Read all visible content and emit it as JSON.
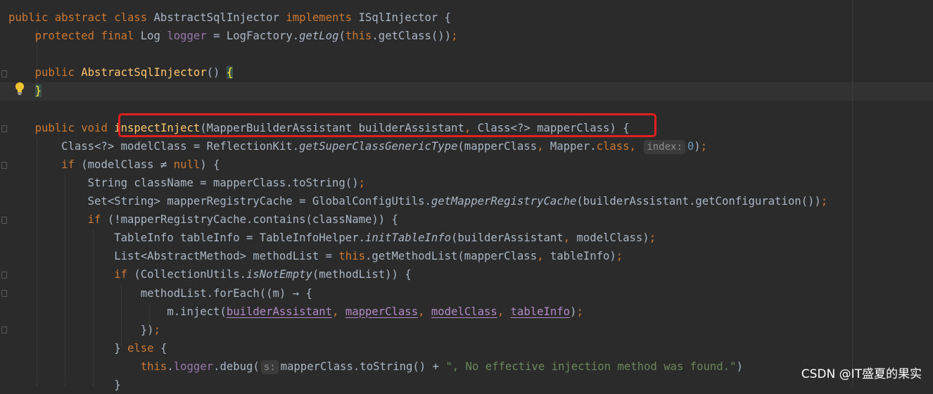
{
  "editor": {
    "lines": [
      [
        [
          "k",
          "public abstract class "
        ],
        [
          "t",
          "AbstractSqlInjector "
        ],
        [
          "k",
          "implements "
        ],
        [
          "t",
          "ISqlInjector {"
        ]
      ],
      [
        [
          "t",
          "    "
        ],
        [
          "k",
          "protected final "
        ],
        [
          "t",
          "Log "
        ],
        [
          "st",
          "logger"
        ],
        [
          "t",
          " = LogFactory."
        ],
        [
          "i",
          "getLog"
        ],
        [
          "t",
          "("
        ],
        [
          "k",
          "this"
        ],
        [
          "t",
          ".getClass())"
        ],
        [
          "k",
          ";"
        ]
      ],
      [],
      [
        [
          "t",
          "    "
        ],
        [
          "k",
          "public "
        ],
        [
          "f",
          "AbstractSqlInjector"
        ],
        [
          "t",
          "() "
        ],
        [
          "bm",
          "{"
        ]
      ],
      [
        [
          "t",
          "    "
        ],
        [
          "bm",
          "}"
        ]
      ],
      [],
      [
        [
          "t",
          "    "
        ],
        [
          "k",
          "public void "
        ],
        [
          "f",
          "inspectInject"
        ],
        [
          "t",
          "(MapperBuilderAssistant builderAssistant"
        ],
        [
          "k",
          ", "
        ],
        [
          "t",
          "Class<?> mapperClass) {"
        ]
      ],
      [
        [
          "t",
          "        Class<?> modelClass = ReflectionKit."
        ],
        [
          "i",
          "getSuperClassGenericType"
        ],
        [
          "t",
          "(mapperClass"
        ],
        [
          "k",
          ", "
        ],
        [
          "t",
          "Mapper."
        ],
        [
          "k",
          "class, "
        ],
        [
          "hint",
          "index:"
        ],
        [
          "n",
          "0"
        ],
        [
          "t",
          ")"
        ],
        [
          "k",
          ";"
        ]
      ],
      [
        [
          "t",
          "        "
        ],
        [
          "k",
          "if "
        ],
        [
          "t",
          "(modelClass ≠ "
        ],
        [
          "k",
          "null"
        ],
        [
          "t",
          ") {"
        ]
      ],
      [
        [
          "t",
          "            String className = mapperClass.toString()"
        ],
        [
          "k",
          ";"
        ]
      ],
      [
        [
          "t",
          "            Set<String> mapperRegistryCache = GlobalConfigUtils."
        ],
        [
          "i",
          "getMapperRegistryCache"
        ],
        [
          "t",
          "(builderAssistant.getConfiguration())"
        ],
        [
          "k",
          ";"
        ]
      ],
      [
        [
          "t",
          "            "
        ],
        [
          "k",
          "if "
        ],
        [
          "t",
          "(!mapperRegistryCache.contains(className)) {"
        ]
      ],
      [
        [
          "t",
          "                TableInfo tableInfo = TableInfoHelper."
        ],
        [
          "i",
          "initTableInfo"
        ],
        [
          "t",
          "(builderAssistant"
        ],
        [
          "k",
          ", "
        ],
        [
          "t",
          "modelClass)"
        ],
        [
          "k",
          ";"
        ]
      ],
      [
        [
          "t",
          "                List<AbstractMethod> methodList = "
        ],
        [
          "k",
          "this"
        ],
        [
          "t",
          ".getMethodList(mapperClass"
        ],
        [
          "k",
          ", "
        ],
        [
          "t",
          "tableInfo)"
        ],
        [
          "k",
          ";"
        ]
      ],
      [
        [
          "t",
          "                "
        ],
        [
          "k",
          "if "
        ],
        [
          "t",
          "(CollectionUtils."
        ],
        [
          "i",
          "isNotEmpty"
        ],
        [
          "t",
          "(methodList)) {"
        ]
      ],
      [
        [
          "t",
          "                    methodList.forEach((m) → {"
        ]
      ],
      [
        [
          "t",
          "                        m.inject("
        ],
        [
          "u",
          "builderAssistant"
        ],
        [
          "k",
          ", "
        ],
        [
          "u",
          "mapperClass"
        ],
        [
          "k",
          ", "
        ],
        [
          "u",
          "modelClass"
        ],
        [
          "k",
          ", "
        ],
        [
          "u",
          "tableInfo"
        ],
        [
          "t",
          ")"
        ],
        [
          "k",
          ";"
        ]
      ],
      [
        [
          "t",
          "                    })"
        ],
        [
          "k",
          ";"
        ]
      ],
      [
        [
          "t",
          "                } "
        ],
        [
          "k",
          "else "
        ],
        [
          "t",
          "{"
        ]
      ],
      [
        [
          "t",
          "                    "
        ],
        [
          "k",
          "this"
        ],
        [
          "t",
          "."
        ],
        [
          "st",
          "logger"
        ],
        [
          "t",
          ".debug("
        ],
        [
          "hint",
          "s:"
        ],
        [
          "t",
          "mapperClass.toString() + "
        ],
        [
          "s",
          "\", No effective injection method was found.\""
        ],
        [
          "t",
          ")"
        ]
      ],
      [
        [
          "t",
          "                }"
        ]
      ]
    ]
  },
  "watermark": "CSDN @IT盛夏的果实"
}
